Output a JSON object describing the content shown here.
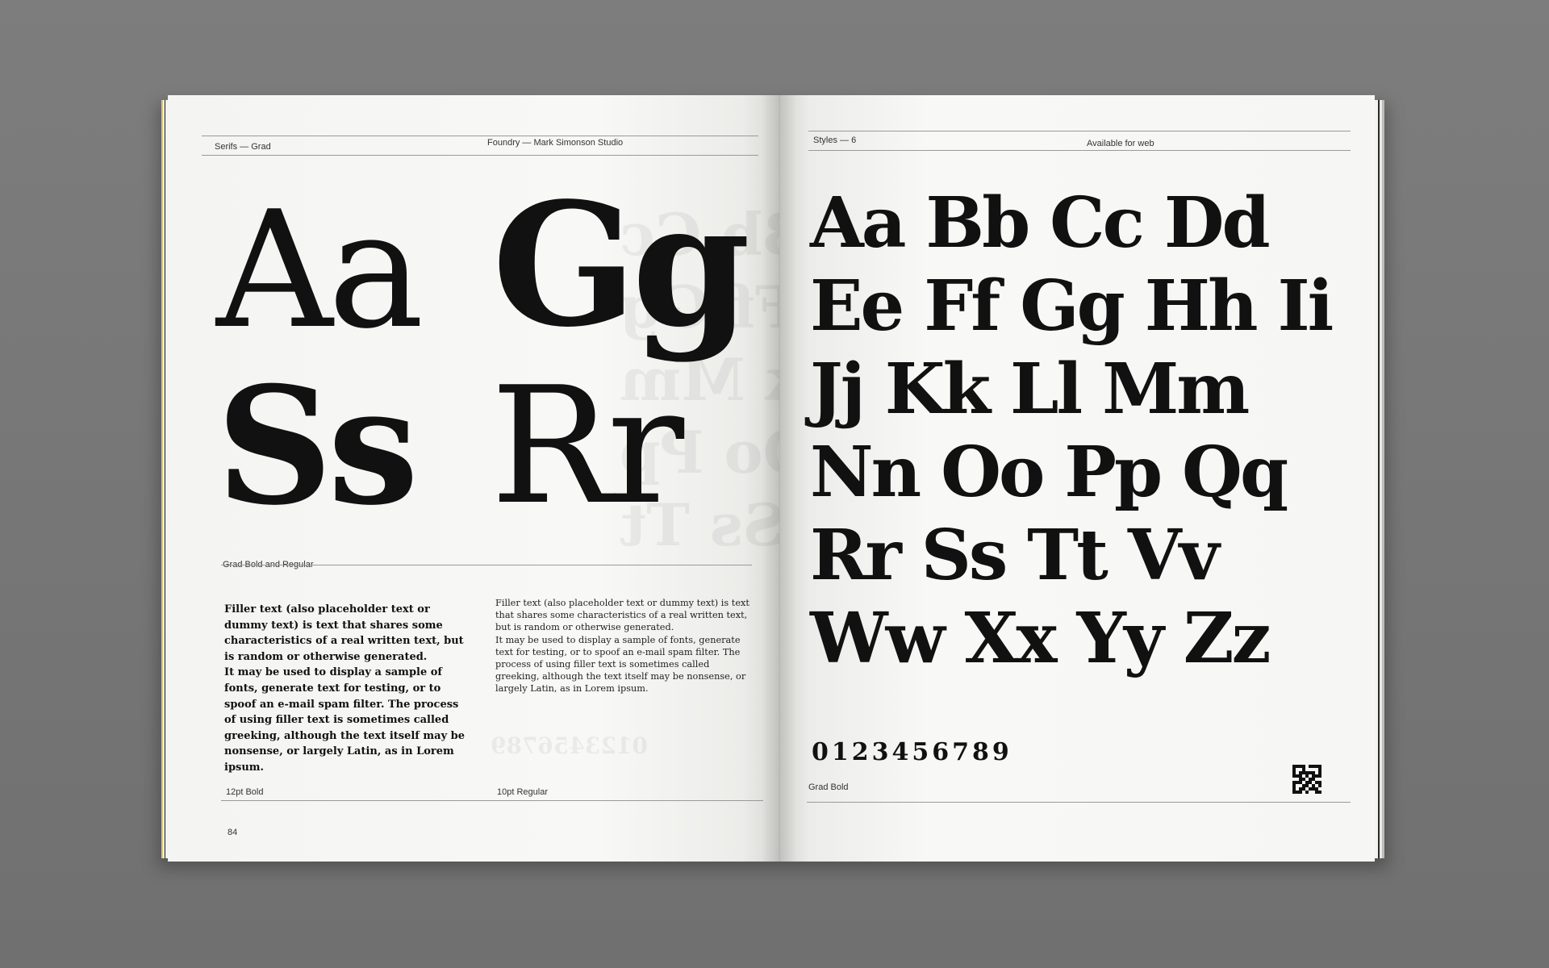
{
  "left_page": {
    "header_left": "Serifs — Grad",
    "header_center": "Foundry — Mark Simonson Studio",
    "specimen_row1": "Aa Gg",
    "specimen_row2": "Ss Rr",
    "specimen_row1_parts": [
      "Aa",
      "Gg"
    ],
    "specimen_row2_parts": [
      "Ss",
      "Rr"
    ],
    "specimen_caption": "Grad Bold and Regular",
    "bold_paragraph": [
      "Filler text (also placeholder text or dummy text) is text that shares some characteris­tics of a real written text, but is random or otherwise generated.",
      "It may be used to display a sample of fonts, generate text for testing, or to spoof an e-mail spam filter. The process of using filler text is sometimes called greeking, although the text itself may be nonsense, or largely Latin, as in Lorem ipsum."
    ],
    "regular_paragraph": [
      "Filler text (also placeholder text or dummy text) is text that shares some characteristics of a real written text, but is random or otherwise generated.",
      "It may be used to display a sample of fonts, generate text for testing, or to spoof an e-mail spam filter. The process of using filler text is sometimes called greeking, al­though the text itself may be nonsense, or largely Latin, as in Lorem ipsum."
    ],
    "bold_label": "12pt Bold",
    "regular_label": "10pt Regular",
    "page_number": "84"
  },
  "right_page": {
    "header_left": "Styles — 6",
    "header_right": "Available for web",
    "alphabet_rows": [
      "Aa Bb Cc Dd",
      "Ee Ff Gg Hh Ii",
      "Jj Kk Ll Mm",
      "Nn Oo Pp Qq",
      "Rr Ss Tt Vv",
      "Ww Xx Yy Zz"
    ],
    "figures": "0123456789",
    "footer_label": "Grad Bold",
    "qr_icon": "qr-code-icon"
  },
  "colors": {
    "background": "#777777",
    "paper": "#f6f6f4",
    "ink": "#111111",
    "page_edge_accent": "#d8c97a"
  }
}
